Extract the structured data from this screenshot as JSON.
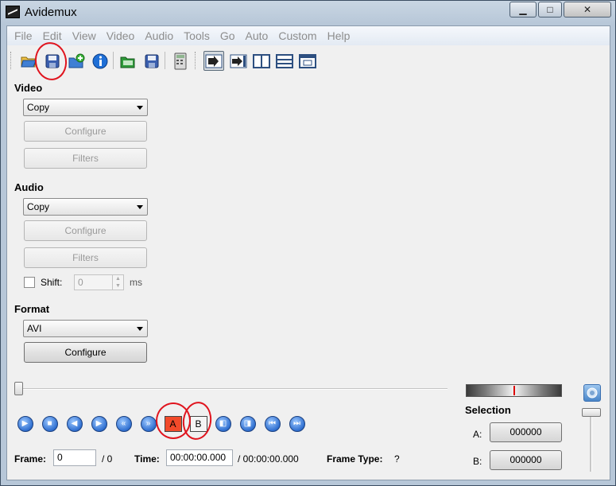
{
  "window": {
    "title": "Avidemux",
    "minimize": "▁",
    "maximize": "□",
    "close": "✕"
  },
  "menu": [
    "File",
    "Edit",
    "View",
    "Video",
    "Audio",
    "Tools",
    "Go",
    "Auto",
    "Custom",
    "Help"
  ],
  "toolbar_icons": [
    "open-icon",
    "save-icon",
    "append-icon",
    "info-icon",
    "save-project-icon",
    "save-as-icon",
    "calculator-icon",
    "input-view-icon",
    "output-view-icon",
    "side-by-side-icon",
    "top-bottom-icon",
    "preview-icon"
  ],
  "video": {
    "title": "Video",
    "codec": "Copy",
    "configure": "Configure",
    "filters": "Filters"
  },
  "audio": {
    "title": "Audio",
    "codec": "Copy",
    "configure": "Configure",
    "filters": "Filters",
    "shift_label": "Shift:",
    "shift_value": "0",
    "shift_unit": "ms"
  },
  "format": {
    "title": "Format",
    "value": "AVI",
    "configure": "Configure"
  },
  "nav_icons": [
    "play-icon",
    "stop-icon",
    "previous-frame-icon",
    "next-frame-icon",
    "previous-keyframe-icon",
    "next-keyframe-icon",
    "marker-a-icon",
    "marker-b-icon",
    "go-to-marker-a-icon",
    "go-to-marker-b-icon",
    "first-frame-icon",
    "last-frame-icon"
  ],
  "marker_a": "A",
  "marker_b": "B",
  "status": {
    "frame_label": "Frame:",
    "frame_value": "0",
    "frame_total": "/ 0",
    "time_label": "Time:",
    "time_value": "00:00:00.000",
    "time_total": "/ 00:00:00.000",
    "frame_type_label": "Frame Type:",
    "frame_type_value": "?"
  },
  "selection": {
    "title": "Selection",
    "a_label": "A:",
    "a_value": "000000",
    "b_label": "B:",
    "b_value": "000000"
  },
  "colors": {
    "annotation": "#e0141e",
    "window_frame": "#b7c7d8",
    "client_bg": "#f0f0f0"
  }
}
